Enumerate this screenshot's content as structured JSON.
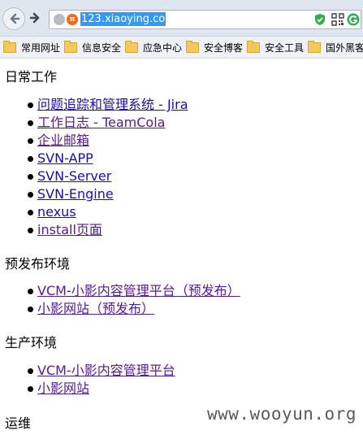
{
  "browser": {
    "url": "123.xiaoying.co",
    "site_badge": "π",
    "icons": [
      "back-arrow-icon",
      "forward-arrow-icon",
      "globe-icon",
      "shield-check-icon",
      "qr-code-icon",
      "g-icon"
    ]
  },
  "bookmarks": [
    {
      "label": "常用网址"
    },
    {
      "label": "信息安全"
    },
    {
      "label": "应急中心"
    },
    {
      "label": "安全博客"
    },
    {
      "label": "安全工具"
    },
    {
      "label": "国外黑客"
    }
  ],
  "sections": [
    {
      "title": "日常工作",
      "links": [
        "问题追踪和管理系统 - Jira",
        "工作日志 - TeamCola",
        "企业邮箱",
        "SVN-APP",
        "SVN-Server",
        "SVN-Engine",
        "nexus",
        "install页面"
      ]
    },
    {
      "title": "预发布环境",
      "links": [
        "VCM-小影内容管理平台（预发布）",
        "小影网站（预发布）"
      ]
    },
    {
      "title": "生产环境",
      "links": [
        "VCM-小影内容管理平台",
        "小影网站"
      ]
    },
    {
      "title": "运维",
      "links": []
    }
  ],
  "watermark": "www.wooyun.org"
}
